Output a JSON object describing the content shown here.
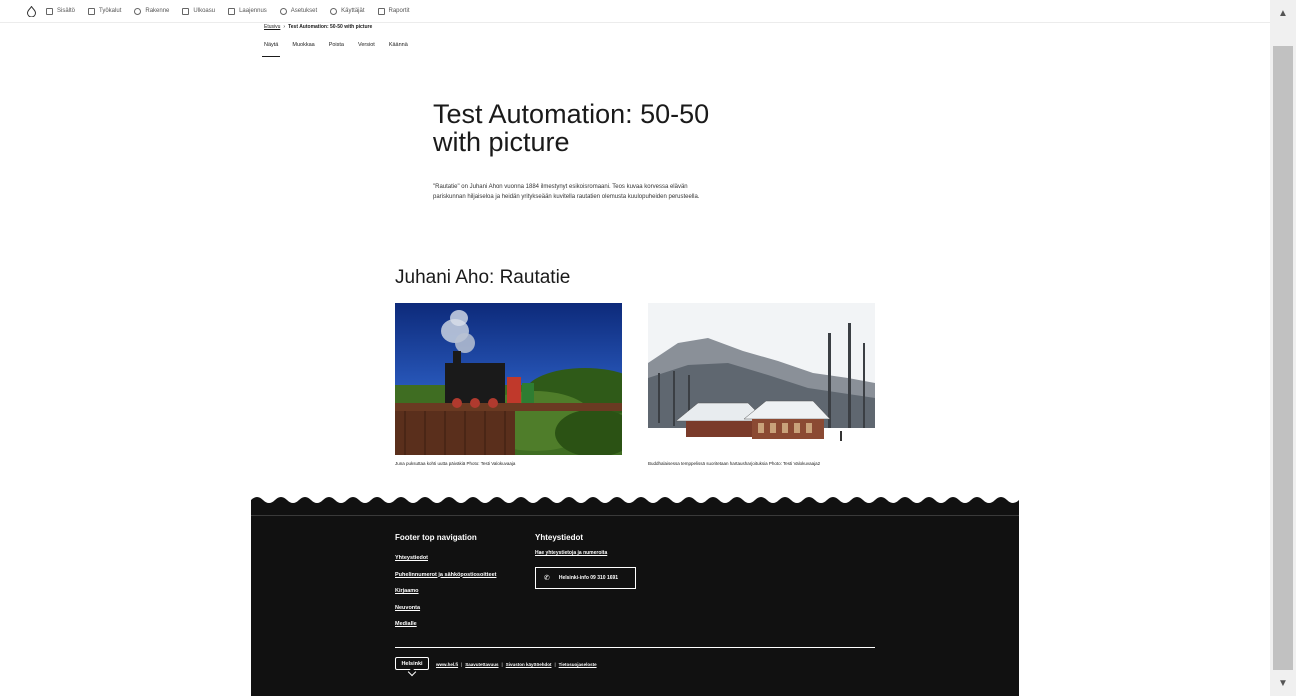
{
  "toolbar": {
    "items": [
      {
        "label": "Sisältö",
        "icon": "content-icon"
      },
      {
        "label": "Työkalut",
        "icon": "tools-icon"
      },
      {
        "label": "Rakenne",
        "icon": "structure-icon"
      },
      {
        "label": "Ulkoasu",
        "icon": "appearance-icon"
      },
      {
        "label": "Laajennus",
        "icon": "extend-icon"
      },
      {
        "label": "Asetukset",
        "icon": "config-icon"
      },
      {
        "label": "Käyttäjät",
        "icon": "people-icon"
      },
      {
        "label": "Raportit",
        "icon": "reports-icon"
      }
    ]
  },
  "breadcrumb": {
    "home": "Etusivu",
    "separator": "›",
    "current": "Test Automation: 50-50 with picture"
  },
  "tabs": [
    "Näytä",
    "Muokkaa",
    "Poista",
    "Versiot",
    "Käännä"
  ],
  "hero": {
    "title": "Test Automation: 50-50 with picture",
    "lead": "\"Rautatie\" on Juhani Ahon vuonna 1884 ilmestynyt esikoisromaani. Teos kuvaa korvessa elävän pariskunnan hiljaiseloa ja heidän yritykseään kuvitella rautatien olemusta kuulopuheiden perusteella."
  },
  "section": {
    "title": "Juhani Aho: Rautatie",
    "figures": [
      {
        "caption": "Juna puksuttaa kohti uutta päiväkiä Photo: Testi Valokuvaaja",
        "subject": "steam-train-on-bridge"
      },
      {
        "caption": "Buddhalaisessa temppelissä suoritetaan hartausharjoituksia Photo: Testi Valokuvaaja2",
        "subject": "snowy-temple"
      }
    ]
  },
  "footer": {
    "nav_heading": "Footer top navigation",
    "nav_items": [
      "Yhteystiedot",
      "Puhelinnumerot ja sähköpostiosoitteet",
      "Kirjaamo",
      "Neuvonta",
      "Medialle"
    ],
    "contact_heading": "Yhteystiedot",
    "contact_link": "Hae yhteystietoja ja numeroita",
    "contact_button": "Helsinki-info 09 310 1691",
    "logo": "Helsinki",
    "bottom_links": [
      "www.hel.fi",
      "Saavutettavuus",
      "Sivuston käyttöehdot",
      "Tietosuojaseloste"
    ],
    "bottom_separator": "|"
  },
  "colors": {
    "footer_bg": "#111111",
    "text": "#1a1a1a"
  }
}
